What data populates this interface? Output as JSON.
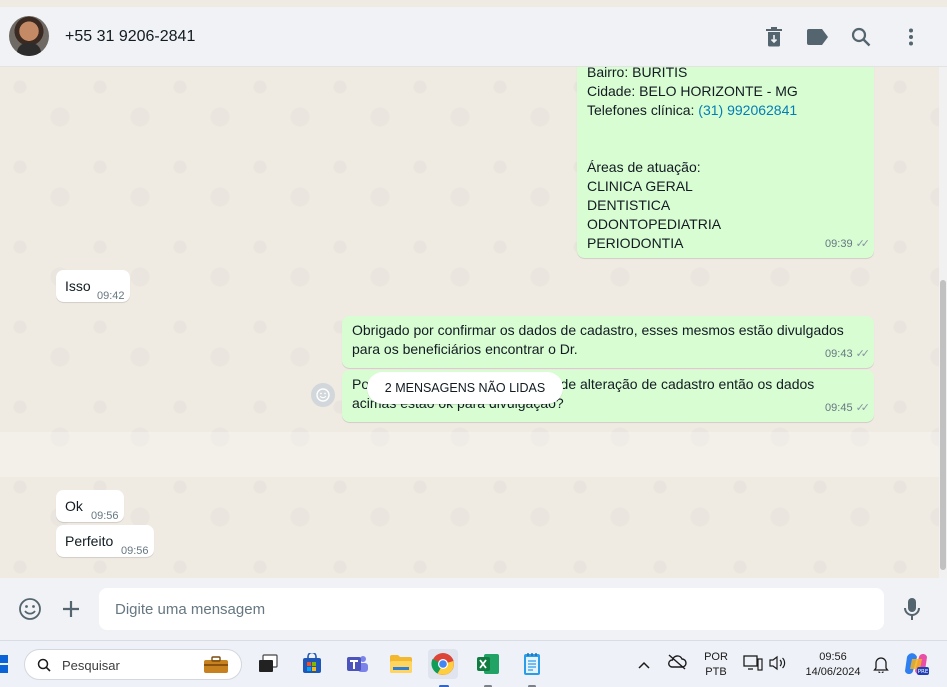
{
  "header": {
    "contact_name": "+55 31 9206-2841",
    "icons": [
      "delete-icon",
      "label-icon",
      "search-icon",
      "menu-icon"
    ]
  },
  "messages": [
    {
      "direction": "outgoing",
      "lines": [
        "Bairro: BURITIS",
        "Cidade: BELO HORIZONTE - MG",
        "Telefones clínica: ",
        "",
        "",
        "Áreas de atuação:",
        "CLINICA GERAL",
        "DENTISTICA",
        "ODONTOPEDIATRIA",
        "PERIODONTIA"
      ],
      "phone_link": "(31) 992062841",
      "time": "09:39"
    },
    {
      "direction": "incoming",
      "text": "Isso",
      "time": "09:42"
    },
    {
      "direction": "outgoing",
      "text": "Obrigado por confirmar os dados de cadastro, esses mesmos estão divulgados para os beneficiários encontrar o Dr.",
      "time": "09:43"
    },
    {
      "direction": "outgoing",
      "text": "Pois, recebemos uma solicitação de alteração de cadastro então os dados acimas estão ok para divulgação?",
      "time": "09:45"
    },
    {
      "direction": "incoming",
      "text": "Ok",
      "time": "09:56"
    },
    {
      "direction": "incoming",
      "text": "Perfeito",
      "time": "09:56"
    }
  ],
  "unread_label": "2 MENSAGENS NÃO LIDAS",
  "composer": {
    "placeholder": "Digite uma mensagem"
  },
  "taskbar": {
    "search_placeholder": "Pesquisar",
    "language": "POR",
    "layout": "PTB",
    "clock_time": "09:56",
    "clock_date": "14/06/2024",
    "apps": [
      "file-explorer-icon",
      "store-icon",
      "teams-icon",
      "folder-icon",
      "chrome-icon",
      "excel-icon",
      "notepad-icon"
    ]
  },
  "colors": {
    "outgoing_bubble": "#d9fdd3",
    "incoming_bubble": "#ffffff",
    "chat_background": "#efeae2",
    "link": "#027eb5"
  }
}
